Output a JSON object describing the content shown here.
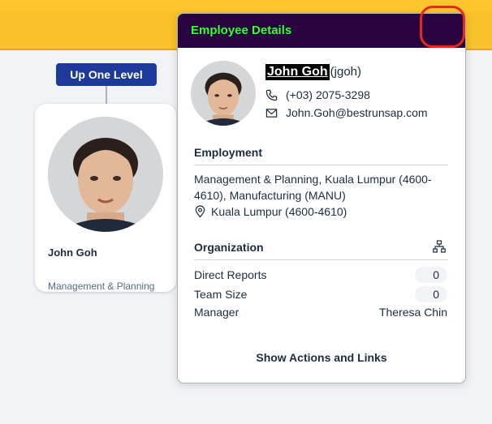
{
  "org_chart": {
    "up_button_label": "Up One Level",
    "card": {
      "name": "John Goh",
      "department": "Management & Planning"
    }
  },
  "popover": {
    "title": "Employee Details",
    "employee": {
      "name": "John Goh",
      "user_id": "(jgoh)",
      "phone": "(+03) 2075-3298",
      "email": "John.Goh@bestrunsap.com"
    },
    "employment": {
      "heading": "Employment",
      "description": "Management & Planning, Kuala Lumpur (4600-4610), Manufacturing (MANU)",
      "location": "Kuala Lumpur (4600-4610)"
    },
    "organization": {
      "heading": "Organization",
      "direct_reports_label": "Direct Reports",
      "direct_reports_value": "0",
      "team_size_label": "Team Size",
      "team_size_value": "0",
      "manager_label": "Manager",
      "manager_value": "Theresa Chin"
    },
    "actions_label": "Show Actions and Links"
  },
  "colors": {
    "topbar": "#f9c22a",
    "header": "#29033f",
    "title": "#33ff33",
    "button": "#1d3a9b",
    "highlight": "#e32a1f"
  },
  "icons": [
    "phone-icon",
    "mail-icon",
    "location-icon",
    "org-chart-icon"
  ]
}
